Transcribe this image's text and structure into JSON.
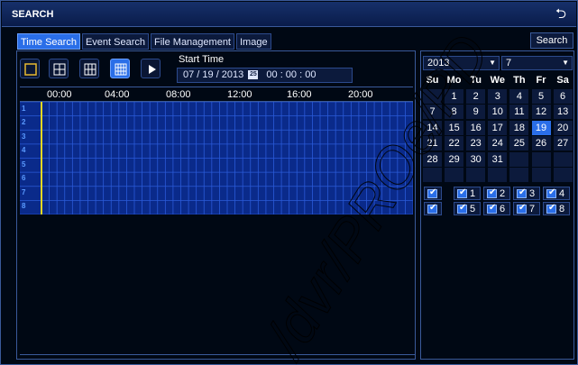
{
  "window": {
    "title": "SEARCH",
    "back_icon": "return-icon"
  },
  "tabs": [
    {
      "label": "Time Search",
      "active": true
    },
    {
      "label": "Event Search",
      "active": false
    },
    {
      "label": "File Management",
      "active": false
    },
    {
      "label": "Image",
      "active": false
    }
  ],
  "search_button": "Search",
  "toolbar": {
    "modes": [
      "single-view-icon",
      "quad-view-icon",
      "nine-view-icon",
      "sixteen-view-icon"
    ],
    "active_mode": 3,
    "play_icon": "play-icon"
  },
  "start_time": {
    "label": "Start Time",
    "date": "07 / 19 / 2013",
    "calendar_icon_text": "25",
    "time": "00  :  00  :  00"
  },
  "timeline": {
    "hours": [
      "00:00",
      "04:00",
      "08:00",
      "12:00",
      "16:00",
      "20:00"
    ],
    "channels": [
      "1",
      "2",
      "3",
      "4",
      "5",
      "6",
      "7",
      "8"
    ]
  },
  "calendar": {
    "year": "2013",
    "month": "7",
    "weekdays": [
      "Su",
      "Mo",
      "Tu",
      "We",
      "Th",
      "Fr",
      "Sa"
    ],
    "weeks": [
      [
        "",
        "1",
        "2",
        "3",
        "4",
        "5",
        "6"
      ],
      [
        "7",
        "8",
        "9",
        "10",
        "11",
        "12",
        "13"
      ],
      [
        "14",
        "15",
        "16",
        "17",
        "18",
        "19",
        "20"
      ],
      [
        "21",
        "22",
        "23",
        "24",
        "25",
        "26",
        "27"
      ],
      [
        "28",
        "29",
        "30",
        "31",
        "",
        "",
        ""
      ],
      [
        "",
        "",
        "",
        "",
        "",
        "",
        ""
      ]
    ],
    "selected_day": "19"
  },
  "channels_checked": [
    {
      "label": "",
      "checked": true
    },
    {
      "label": "1",
      "checked": true
    },
    {
      "label": "2",
      "checked": true
    },
    {
      "label": "3",
      "checked": true
    },
    {
      "label": "4",
      "checked": true
    },
    {
      "label": "",
      "checked": true
    },
    {
      "label": "5",
      "checked": true
    },
    {
      "label": "6",
      "checked": true
    },
    {
      "label": "7",
      "checked": true
    },
    {
      "label": "8",
      "checked": true
    }
  ],
  "colors": {
    "accent": "#2a6ee8",
    "panel": "#0c1a3c",
    "border": "#3a5a9a",
    "cursor": "#e8d820"
  }
}
